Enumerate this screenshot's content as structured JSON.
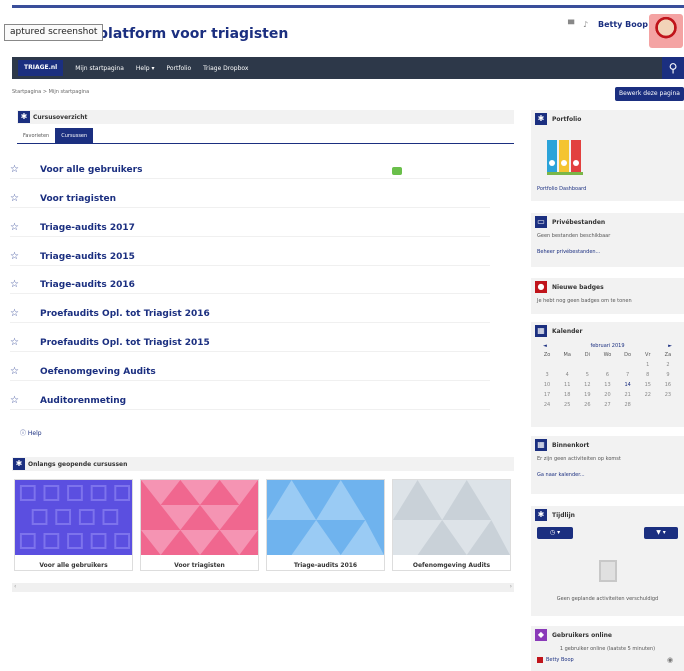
{
  "tooltip": "aptured screenshot",
  "site_title": "platform voor triagisten",
  "header": {
    "user_name": "Betty Boop ˅"
  },
  "nav": {
    "brand": "TRIAGE.nl",
    "items": [
      "Mijn startpagina",
      "Help ▾",
      "Portfolio",
      "Triage Dropbox"
    ]
  },
  "breadcrumb": "Startpagina > Mijn startpagina",
  "edit_button": "Bewerk deze pagina",
  "overview": {
    "title": "Cursusoverzicht",
    "tabs": [
      "Favorieten",
      "Cursussen"
    ],
    "courses": [
      "Voor alle gebruikers",
      "Voor triagisten",
      "Triage-audits 2017",
      "Triage-audits 2015",
      "Triage-audits 2016",
      "Proefaudits Opl. tot Triagist 2016",
      "Proefaudits Opl. tot Triagist 2015",
      "Oefenomgeving Audits",
      "Auditorenmeting"
    ],
    "help": "Help"
  },
  "recent": {
    "title": "Onlangs geopende cursussen",
    "cards": [
      {
        "label": "Voor alle gebruikers",
        "color": "#5b4fe0"
      },
      {
        "label": "Voor triagisten",
        "color": "#f0678f"
      },
      {
        "label": "Triage-audits 2016",
        "color": "#6fb3ee"
      },
      {
        "label": "Oefenomgeving Audits",
        "color": "#dde3e8"
      }
    ]
  },
  "sidebar": {
    "portfolio": {
      "title": "Portfolio",
      "link": "Portfolio Dashboard"
    },
    "private_files": {
      "title": "Privébestanden",
      "empty": "Geen bestanden beschikbaar",
      "link": "Beheer privébestanden..."
    },
    "badges": {
      "title": "Nieuwe badges",
      "text": "Je hebt nog geen badges om te tonen"
    },
    "calendar": {
      "title": "Kalender",
      "month": "februari 2019",
      "prev": "◄",
      "next": "►",
      "weekdays": [
        "Zo",
        "Ma",
        "Di",
        "Wo",
        "Do",
        "Vr",
        "Za"
      ],
      "days": [
        "",
        "",
        "",
        "",
        "",
        "1",
        "2",
        "3",
        "4",
        "5",
        "6",
        "7",
        "8",
        "9",
        "10",
        "11",
        "12",
        "13",
        "14",
        "15",
        "16",
        "17",
        "18",
        "19",
        "20",
        "21",
        "22",
        "23",
        "24",
        "25",
        "26",
        "27",
        "28",
        "",
        ""
      ]
    },
    "upcoming": {
      "title": "Binnenkort",
      "text": "Er zijn geen activiteiten op komst",
      "link": "Ga naar kalender..."
    },
    "timeline": {
      "title": "Tijdlijn",
      "btn_left": "◷ ▾",
      "btn_right": "▼ ▾",
      "empty": "Geen geplande activiteiten verschuldigd"
    },
    "online": {
      "title": "Gebruikers online",
      "text": "1 gebruiker online (laatste 5 minuten)",
      "user": "Betty Boop"
    }
  }
}
